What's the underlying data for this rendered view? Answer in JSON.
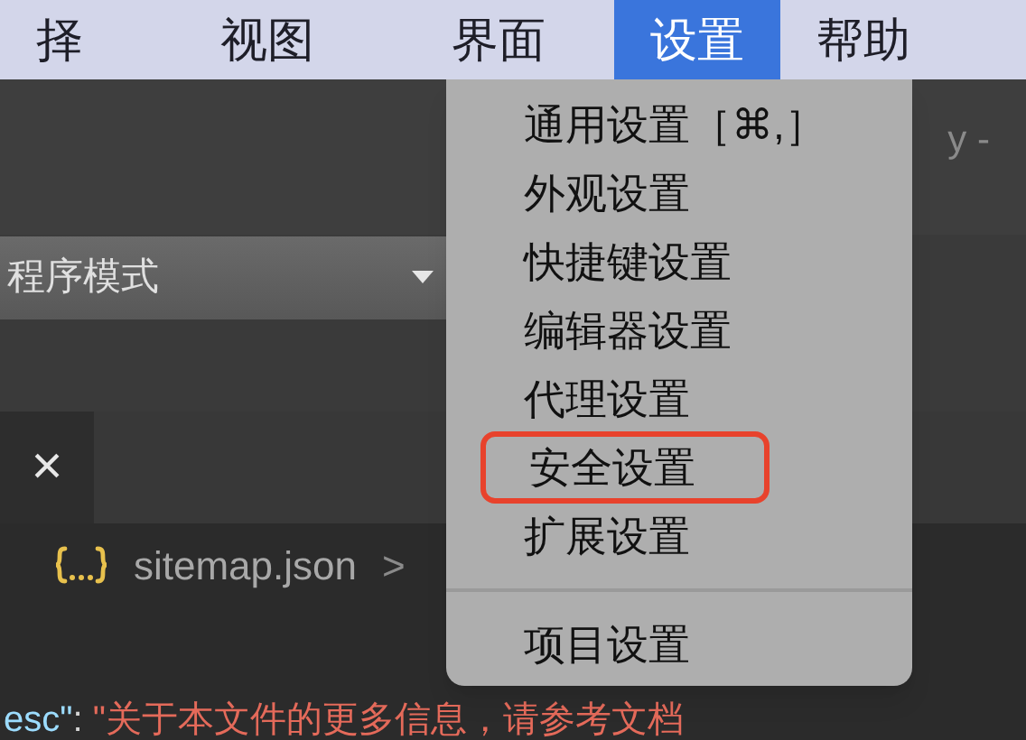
{
  "menu_bar": [
    {
      "label": "择",
      "selected": false
    },
    {
      "label": "视图",
      "selected": false
    },
    {
      "label": "界面",
      "selected": false
    },
    {
      "label": "设置",
      "selected": true
    },
    {
      "label": "帮助",
      "selected": false
    }
  ],
  "window": {
    "title": "y -"
  },
  "toolbar": {
    "mode_dropdown": "程序模式"
  },
  "tab": {
    "close": "×"
  },
  "breadcrumb": {
    "file": "sitemap.json",
    "separator": ">"
  },
  "code_line": {
    "key": "esc\"",
    "colon": ": ",
    "value": "\"关于本文件的更多信息，请参考文档"
  },
  "settings_menu": [
    {
      "kind": "item",
      "label": "通用设置［⌘,］",
      "highlighted": false
    },
    {
      "kind": "item",
      "label": "外观设置",
      "highlighted": false
    },
    {
      "kind": "item",
      "label": "快捷键设置",
      "highlighted": false
    },
    {
      "kind": "item",
      "label": "编辑器设置",
      "highlighted": false
    },
    {
      "kind": "item",
      "label": "代理设置",
      "highlighted": false
    },
    {
      "kind": "item",
      "label": "安全设置",
      "highlighted": true
    },
    {
      "kind": "item",
      "label": "扩展设置",
      "highlighted": false
    },
    {
      "kind": "separator"
    },
    {
      "kind": "item",
      "label": "项目设置",
      "highlighted": false
    }
  ]
}
